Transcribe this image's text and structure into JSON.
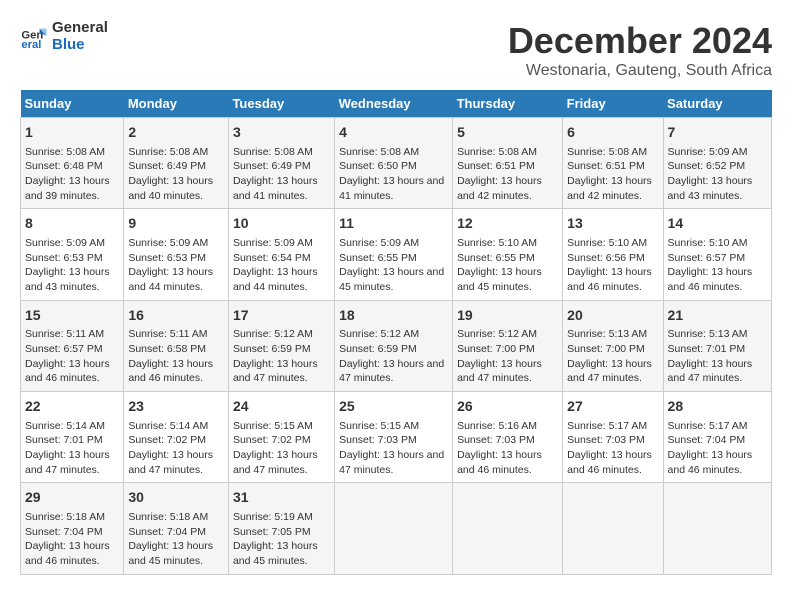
{
  "header": {
    "logo_general": "General",
    "logo_blue": "Blue",
    "title": "December 2024",
    "subtitle": "Westonaria, Gauteng, South Africa"
  },
  "columns": [
    "Sunday",
    "Monday",
    "Tuesday",
    "Wednesday",
    "Thursday",
    "Friday",
    "Saturday"
  ],
  "weeks": [
    {
      "days": [
        {
          "num": "1",
          "sunrise": "Sunrise: 5:08 AM",
          "sunset": "Sunset: 6:48 PM",
          "daylight": "Daylight: 13 hours and 39 minutes."
        },
        {
          "num": "2",
          "sunrise": "Sunrise: 5:08 AM",
          "sunset": "Sunset: 6:49 PM",
          "daylight": "Daylight: 13 hours and 40 minutes."
        },
        {
          "num": "3",
          "sunrise": "Sunrise: 5:08 AM",
          "sunset": "Sunset: 6:49 PM",
          "daylight": "Daylight: 13 hours and 41 minutes."
        },
        {
          "num": "4",
          "sunrise": "Sunrise: 5:08 AM",
          "sunset": "Sunset: 6:50 PM",
          "daylight": "Daylight: 13 hours and 41 minutes."
        },
        {
          "num": "5",
          "sunrise": "Sunrise: 5:08 AM",
          "sunset": "Sunset: 6:51 PM",
          "daylight": "Daylight: 13 hours and 42 minutes."
        },
        {
          "num": "6",
          "sunrise": "Sunrise: 5:08 AM",
          "sunset": "Sunset: 6:51 PM",
          "daylight": "Daylight: 13 hours and 42 minutes."
        },
        {
          "num": "7",
          "sunrise": "Sunrise: 5:09 AM",
          "sunset": "Sunset: 6:52 PM",
          "daylight": "Daylight: 13 hours and 43 minutes."
        }
      ]
    },
    {
      "days": [
        {
          "num": "8",
          "sunrise": "Sunrise: 5:09 AM",
          "sunset": "Sunset: 6:53 PM",
          "daylight": "Daylight: 13 hours and 43 minutes."
        },
        {
          "num": "9",
          "sunrise": "Sunrise: 5:09 AM",
          "sunset": "Sunset: 6:53 PM",
          "daylight": "Daylight: 13 hours and 44 minutes."
        },
        {
          "num": "10",
          "sunrise": "Sunrise: 5:09 AM",
          "sunset": "Sunset: 6:54 PM",
          "daylight": "Daylight: 13 hours and 44 minutes."
        },
        {
          "num": "11",
          "sunrise": "Sunrise: 5:09 AM",
          "sunset": "Sunset: 6:55 PM",
          "daylight": "Daylight: 13 hours and 45 minutes."
        },
        {
          "num": "12",
          "sunrise": "Sunrise: 5:10 AM",
          "sunset": "Sunset: 6:55 PM",
          "daylight": "Daylight: 13 hours and 45 minutes."
        },
        {
          "num": "13",
          "sunrise": "Sunrise: 5:10 AM",
          "sunset": "Sunset: 6:56 PM",
          "daylight": "Daylight: 13 hours and 46 minutes."
        },
        {
          "num": "14",
          "sunrise": "Sunrise: 5:10 AM",
          "sunset": "Sunset: 6:57 PM",
          "daylight": "Daylight: 13 hours and 46 minutes."
        }
      ]
    },
    {
      "days": [
        {
          "num": "15",
          "sunrise": "Sunrise: 5:11 AM",
          "sunset": "Sunset: 6:57 PM",
          "daylight": "Daylight: 13 hours and 46 minutes."
        },
        {
          "num": "16",
          "sunrise": "Sunrise: 5:11 AM",
          "sunset": "Sunset: 6:58 PM",
          "daylight": "Daylight: 13 hours and 46 minutes."
        },
        {
          "num": "17",
          "sunrise": "Sunrise: 5:12 AM",
          "sunset": "Sunset: 6:59 PM",
          "daylight": "Daylight: 13 hours and 47 minutes."
        },
        {
          "num": "18",
          "sunrise": "Sunrise: 5:12 AM",
          "sunset": "Sunset: 6:59 PM",
          "daylight": "Daylight: 13 hours and 47 minutes."
        },
        {
          "num": "19",
          "sunrise": "Sunrise: 5:12 AM",
          "sunset": "Sunset: 7:00 PM",
          "daylight": "Daylight: 13 hours and 47 minutes."
        },
        {
          "num": "20",
          "sunrise": "Sunrise: 5:13 AM",
          "sunset": "Sunset: 7:00 PM",
          "daylight": "Daylight: 13 hours and 47 minutes."
        },
        {
          "num": "21",
          "sunrise": "Sunrise: 5:13 AM",
          "sunset": "Sunset: 7:01 PM",
          "daylight": "Daylight: 13 hours and 47 minutes."
        }
      ]
    },
    {
      "days": [
        {
          "num": "22",
          "sunrise": "Sunrise: 5:14 AM",
          "sunset": "Sunset: 7:01 PM",
          "daylight": "Daylight: 13 hours and 47 minutes."
        },
        {
          "num": "23",
          "sunrise": "Sunrise: 5:14 AM",
          "sunset": "Sunset: 7:02 PM",
          "daylight": "Daylight: 13 hours and 47 minutes."
        },
        {
          "num": "24",
          "sunrise": "Sunrise: 5:15 AM",
          "sunset": "Sunset: 7:02 PM",
          "daylight": "Daylight: 13 hours and 47 minutes."
        },
        {
          "num": "25",
          "sunrise": "Sunrise: 5:15 AM",
          "sunset": "Sunset: 7:03 PM",
          "daylight": "Daylight: 13 hours and 47 minutes."
        },
        {
          "num": "26",
          "sunrise": "Sunrise: 5:16 AM",
          "sunset": "Sunset: 7:03 PM",
          "daylight": "Daylight: 13 hours and 46 minutes."
        },
        {
          "num": "27",
          "sunrise": "Sunrise: 5:17 AM",
          "sunset": "Sunset: 7:03 PM",
          "daylight": "Daylight: 13 hours and 46 minutes."
        },
        {
          "num": "28",
          "sunrise": "Sunrise: 5:17 AM",
          "sunset": "Sunset: 7:04 PM",
          "daylight": "Daylight: 13 hours and 46 minutes."
        }
      ]
    },
    {
      "days": [
        {
          "num": "29",
          "sunrise": "Sunrise: 5:18 AM",
          "sunset": "Sunset: 7:04 PM",
          "daylight": "Daylight: 13 hours and 46 minutes."
        },
        {
          "num": "30",
          "sunrise": "Sunrise: 5:18 AM",
          "sunset": "Sunset: 7:04 PM",
          "daylight": "Daylight: 13 hours and 45 minutes."
        },
        {
          "num": "31",
          "sunrise": "Sunrise: 5:19 AM",
          "sunset": "Sunset: 7:05 PM",
          "daylight": "Daylight: 13 hours and 45 minutes."
        },
        null,
        null,
        null,
        null
      ]
    }
  ]
}
